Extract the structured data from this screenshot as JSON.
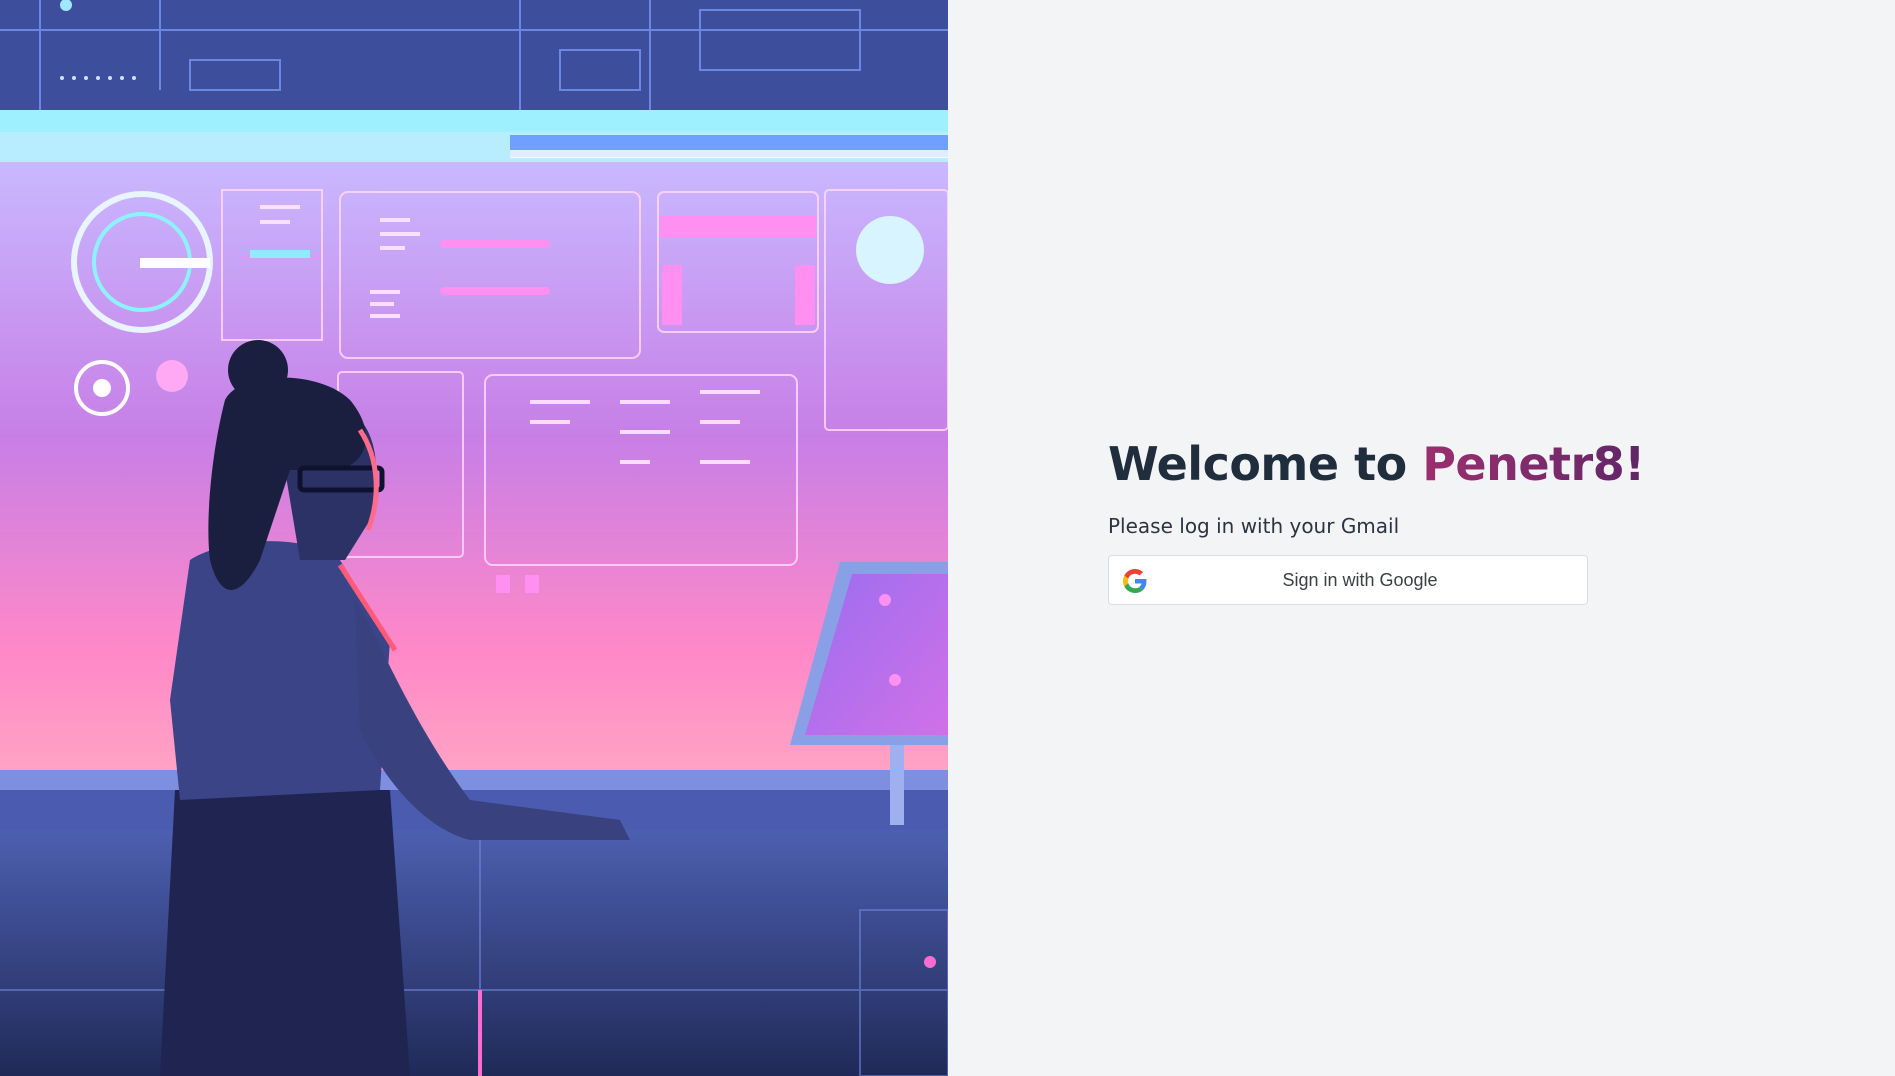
{
  "hero": {
    "illustration": "woman-at-cyber-control-console"
  },
  "login": {
    "title_prefix": "Welcome to ",
    "brand_name": "Penetr8!",
    "subtitle": "Please log in with your Gmail",
    "google_button_label": "Sign in with Google",
    "google_icon": "google-g-icon"
  },
  "colors": {
    "background": "#f3f4f6",
    "title": "#1f2d3d",
    "brand": "#8f2d6d",
    "button_border": "#dadce0"
  }
}
